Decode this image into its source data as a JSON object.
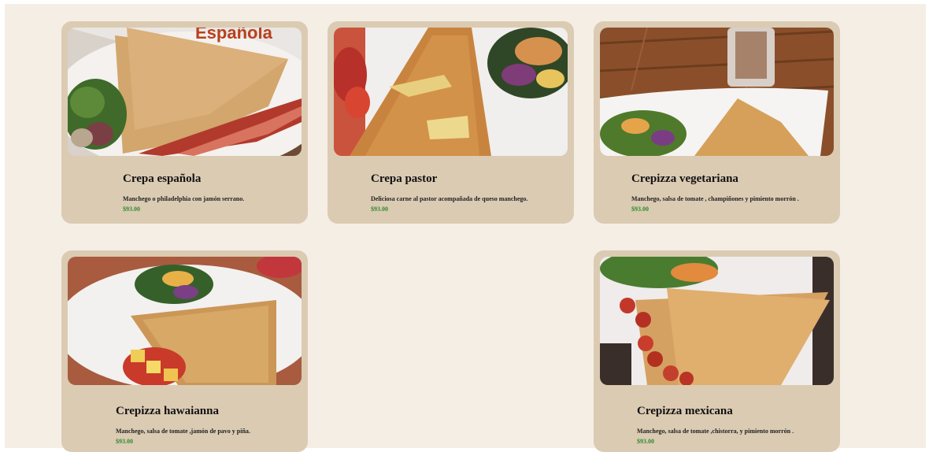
{
  "theme": {
    "page_background": "#f5eee5",
    "card_background": "#dbcbb3",
    "price_color": "#2f8a2f"
  },
  "menu": {
    "items": [
      {
        "name": "Crepa española",
        "description": "Manchego o philadelphia con jamón serrano.",
        "price": "$93.00",
        "photo_sign": "Española"
      },
      {
        "name": "Crepa pastor",
        "description": "Deliciosa carne al pastor acompañada de queso manchego.",
        "price": "$93.00"
      },
      {
        "name": "Crepizza vegetariana",
        "description": "Manchego, salsa de tomate , champiñones y pimiento morrón .",
        "price": "$93.00"
      },
      {
        "name": "Crepizza hawaianna",
        "description": "Manchego, salsa de tomate ,jamón de pavo y piña.",
        "price": "$93.00"
      },
      {
        "name": "Crepizza mexicana",
        "description": "Manchego, salsa de tomate ,chistorra, y pimiento morrón .",
        "price": "$93.00"
      }
    ]
  }
}
